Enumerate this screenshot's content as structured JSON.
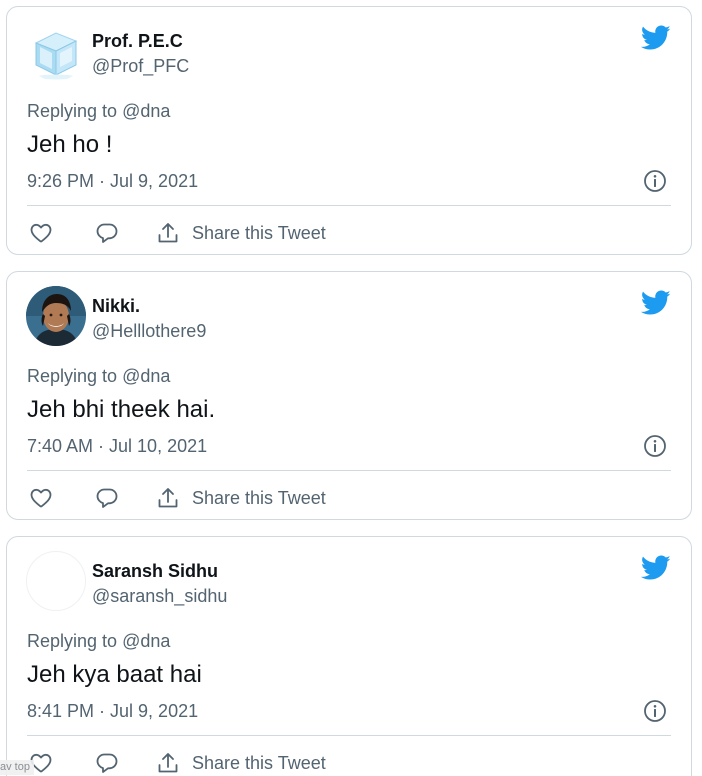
{
  "colors": {
    "twitter_blue": "#1d9bf0",
    "secondary_text": "#536471",
    "primary_text": "#0f1419",
    "border": "#cfd9de"
  },
  "tweets": [
    {
      "avatar": "ice-cube-avatar",
      "display_name": "Prof. P.E.C",
      "handle": "@Prof_PFC",
      "replying_prefix": "Replying to",
      "replying_mention": "@dna",
      "text": "Jeh ho !",
      "timestamp": "9:26 PM · Jul 9, 2021",
      "share_label": "Share this Tweet"
    },
    {
      "avatar": "person-photo-avatar",
      "display_name": "Nikki.",
      "handle": "@Helllothere9",
      "replying_prefix": "Replying to",
      "replying_mention": "@dna",
      "text": "Jeh bhi theek hai.",
      "timestamp": "7:40 AM · Jul 10, 2021",
      "share_label": "Share this Tweet"
    },
    {
      "avatar": "blank-avatar",
      "display_name": "Saransh Sidhu",
      "handle": "@saransh_sidhu",
      "replying_prefix": "Replying to",
      "replying_mention": "@dna",
      "text": "Jeh kya baat hai",
      "timestamp": "8:41 PM · Jul 9, 2021",
      "share_label": "Share this Tweet"
    }
  ],
  "icons": {
    "brand": "twitter-bird-icon",
    "info": "info-icon",
    "like": "heart-icon",
    "reply": "reply-bubble-icon",
    "share": "share-upload-icon"
  },
  "overlay": {
    "corner_text": "av top"
  }
}
